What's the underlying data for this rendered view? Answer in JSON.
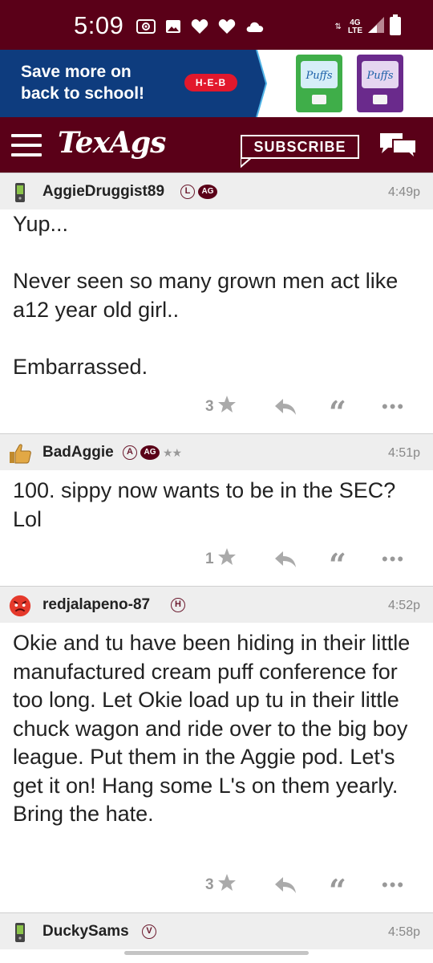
{
  "status_bar": {
    "time": "5:09",
    "network": "4G\nLTE",
    "net_line1": "4G",
    "net_line2": "LTE",
    "icons": [
      "radio-icon",
      "image-icon",
      "heart-icon",
      "heart-icon",
      "cloud-icon",
      "data-arrows-icon",
      "signal-icon",
      "battery-icon"
    ]
  },
  "ad": {
    "line1": "Save more on",
    "line2": "back to school!",
    "brand": "H-E-B",
    "product_brand": "Puffs"
  },
  "nav": {
    "logo": "TexAgs",
    "subscribe_label": "SUBSCRIBE"
  },
  "colors": {
    "brand_maroon": "#5a0018",
    "ad_blue": "#0e3c7e",
    "heb_red": "#e2182c",
    "header_gray": "#eeeeee",
    "action_gray": "#999999"
  },
  "posts": [
    {
      "username": "AggieDruggist89",
      "badges": [
        "L",
        "AG"
      ],
      "time": "4:49p",
      "body": "Yup...\n\nNever seen so many grown men act like a12 year old girl..\n\nEmbarrassed.",
      "rating": "3",
      "avatar_icon": "phone-icon"
    },
    {
      "username": "BadAggie",
      "badges": [
        "A",
        "AG"
      ],
      "stars": "★★",
      "time": "4:51p",
      "body": "100. sippy now wants to be in the SEC? Lol",
      "rating": "1",
      "avatar_icon": "thumbs-up-icon"
    },
    {
      "username": "redjalapeno-87",
      "badges": [
        "H"
      ],
      "time": "4:52p",
      "body": "Okie and tu have been hiding in their little manufactured cream puff conference for too long. Let Okie load up tu in their little chuck wagon and ride over to the big boy league. Put them in the Aggie pod. Let's get it on! Hang some L's on them yearly. Bring the hate.",
      "rating": "3",
      "avatar_icon": "angry-face-icon"
    },
    {
      "username": "DuckySams",
      "badges": [
        "V"
      ],
      "time": "4:58p",
      "avatar_icon": "phone-icon"
    }
  ]
}
